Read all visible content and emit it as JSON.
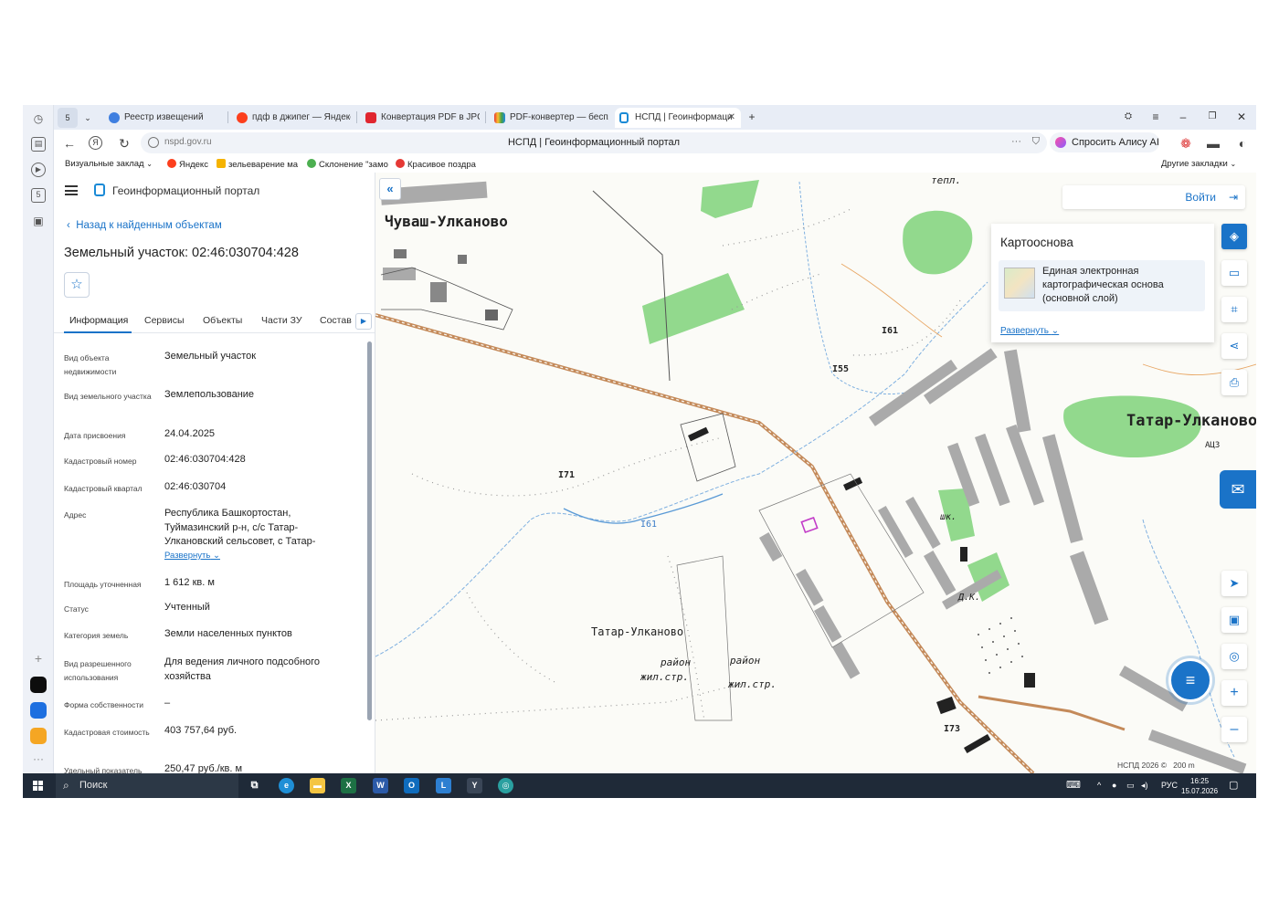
{
  "browser": {
    "tab_counter": "5",
    "tabs": [
      {
        "title": "Реестр извещений"
      },
      {
        "title": "пдф в джипег — Яндекс: н"
      },
      {
        "title": "Конвертация PDF в JPG. Н"
      },
      {
        "title": "PDF-конвертер — беспла"
      },
      {
        "title": "НСПД | Геоинформаци"
      }
    ],
    "new_tab": "+",
    "address": {
      "host": "nspd.gov.ru",
      "page_title": "НСПД | Геоинформационный портал",
      "more": "···"
    },
    "alice_label": "Спросить Алису AI",
    "bookmarks": [
      {
        "label": "Визуальные заклад",
        "color": "#ffffff"
      },
      {
        "label": "Яндекс",
        "color": "#fc3f1d"
      },
      {
        "label": "зельеварение ма",
        "color": "#f5b300"
      },
      {
        "label": "Склонение \"замо",
        "color": "#4caf50"
      },
      {
        "label": "Красивое поздра",
        "color": "#e53935"
      }
    ],
    "other_bookmarks": "Другие закладки"
  },
  "panel": {
    "brand": "Геоинформационный портал",
    "back_link": "Назад к найденным объектам",
    "title": "Земельный участок: 02:46:030704:428",
    "tabs": [
      "Информация",
      "Сервисы",
      "Объекты",
      "Части ЗУ",
      "Состав"
    ],
    "fields": [
      {
        "key": "Вид объекта недвижимости",
        "value": "Земельный участок"
      },
      {
        "key": "Вид земельного участка",
        "value": "Землепользование"
      },
      {
        "key": "Дата присвоения",
        "value": "24.04.2025"
      },
      {
        "key": "Кадастровый номер",
        "value": "02:46:030704:428"
      },
      {
        "key": "Кадастровый квартал",
        "value": "02:46:030704"
      },
      {
        "key": "Адрес",
        "value": "Республика Башкортостан, Туймазинский р-н, с/с Татар-Улкановский сельсовет, с Татар-"
      },
      {
        "key": "Площадь уточненная",
        "value": "1 612 кв. м"
      },
      {
        "key": "Статус",
        "value": "Учтенный"
      },
      {
        "key": "Категория земель",
        "value": "Земли населенных пунктов"
      },
      {
        "key": "Вид разрешенного использования",
        "value": "Для ведения личного подсобного хозяйства"
      },
      {
        "key": "Форма собственности",
        "value": "–"
      },
      {
        "key": "Кадастровая стоимость",
        "value": "403 757,64 руб."
      },
      {
        "key": "Удельный показатель",
        "value": "250,47 руб./кв. м"
      }
    ],
    "expand_link": "Развернуть"
  },
  "map": {
    "login": "Войти",
    "layers_title": "Картооснова",
    "layer_name": "Единая электронная картографическая основа (основной слой)",
    "layers_expand": "Развернуть",
    "labels": {
      "village1": "Чуваш-Улканово",
      "village2": "Татар-Улканово",
      "village3": "Татар-Улканово",
      "tepl": "тепл.",
      "h161a": "I61",
      "h161b": "I61",
      "h155": "I55",
      "h171": "I71",
      "h173": "I73",
      "acz": "АЦЗ",
      "district1": "район",
      "district1b": "жил.стр.",
      "district2": "район",
      "district2b": "жил.стр.",
      "shk": "шк.",
      "dk": "Д.К."
    },
    "attribution": "НСПД 2026 ©",
    "scale": "200 m"
  },
  "taskbar": {
    "search": "Поиск",
    "lang": "РУС",
    "time": "16:25",
    "date": "15.07.2026"
  }
}
